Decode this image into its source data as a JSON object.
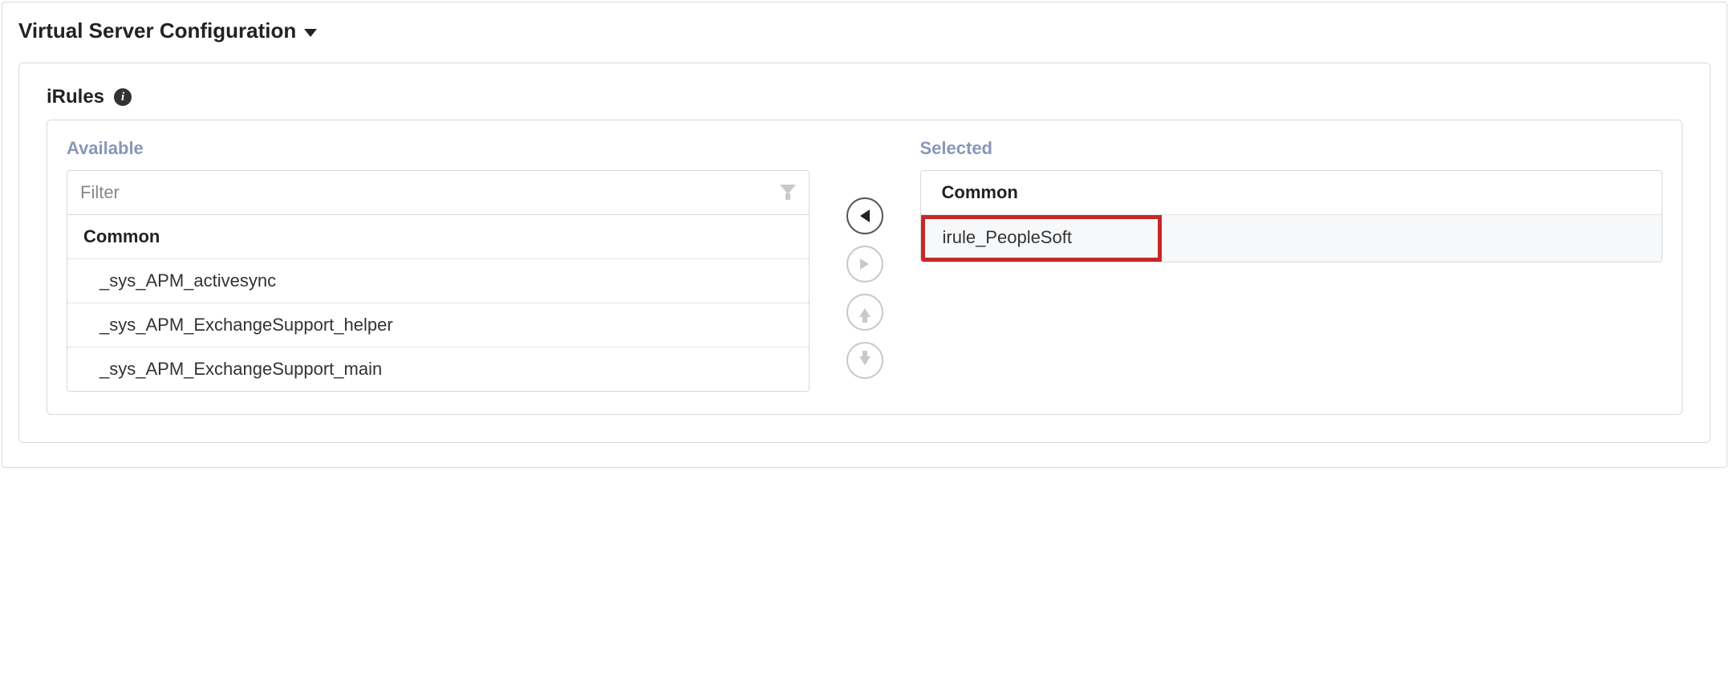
{
  "section": {
    "title": "Virtual Server Configuration"
  },
  "field": {
    "label": "iRules"
  },
  "duallist": {
    "available": {
      "title": "Available",
      "filter_placeholder": "Filter",
      "group": "Common",
      "items": [
        "_sys_APM_activesync",
        "_sys_APM_ExchangeSupport_helper",
        "_sys_APM_ExchangeSupport_main"
      ]
    },
    "selected": {
      "title": "Selected",
      "group": "Common",
      "items": [
        "irule_PeopleSoft"
      ]
    }
  }
}
